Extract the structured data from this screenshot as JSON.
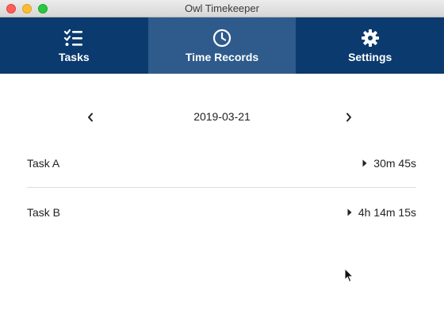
{
  "window": {
    "title": "Owl Timekeeper"
  },
  "nav": {
    "tabs": [
      {
        "label": "Tasks",
        "icon": "tasks-list-icon",
        "active": false
      },
      {
        "label": "Time Records",
        "icon": "clock-icon",
        "active": true
      },
      {
        "label": "Settings",
        "icon": "gear-icon",
        "active": false
      }
    ]
  },
  "date_nav": {
    "date": "2019-03-21"
  },
  "records": [
    {
      "task": "Task A",
      "duration": "30m 45s"
    },
    {
      "task": "Task B",
      "duration": "4h 14m 15s"
    }
  ],
  "colors": {
    "nav_bg": "#0b3a6e",
    "nav_active": "#2e5b8b"
  }
}
